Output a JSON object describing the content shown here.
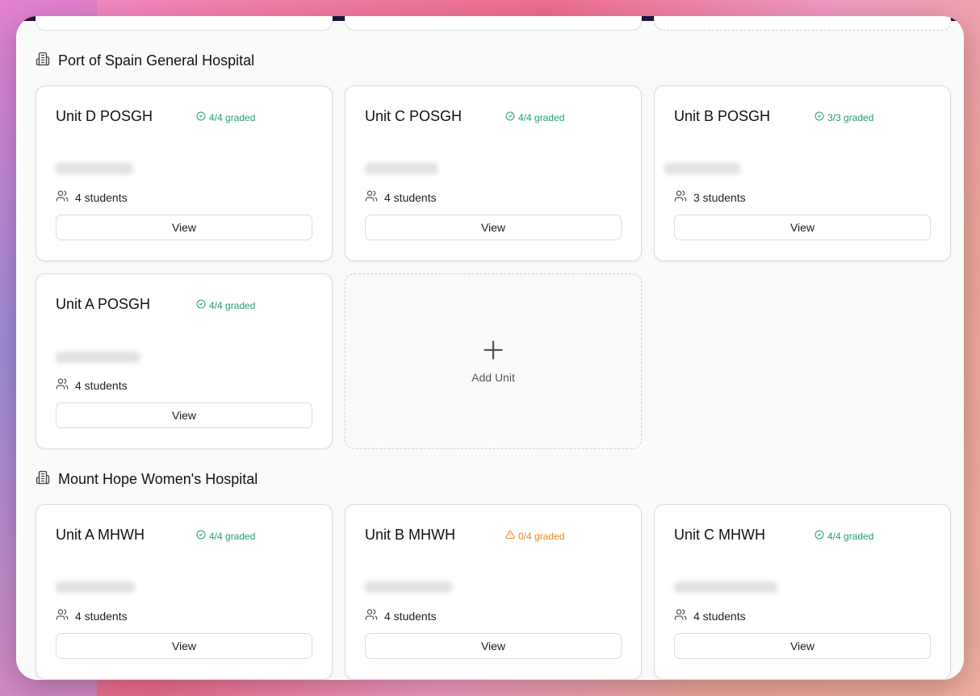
{
  "sections": [
    {
      "title": "Port of Spain General Hospital",
      "units": [
        {
          "name": "Unit D POSGH",
          "graded": "4/4 graded",
          "status": "ok",
          "students": "4 students",
          "view": "View"
        },
        {
          "name": "Unit C POSGH",
          "graded": "4/4 graded",
          "status": "ok",
          "students": "4 students",
          "view": "View"
        },
        {
          "name": "Unit B POSGH",
          "graded": "3/3 graded",
          "status": "ok",
          "students": "3 students",
          "view": "View"
        },
        {
          "name": "Unit A POSGH",
          "graded": "4/4 graded",
          "status": "ok",
          "students": "4 students",
          "view": "View"
        }
      ],
      "add_label": "Add Unit"
    },
    {
      "title": "Mount Hope Women's Hospital",
      "units": [
        {
          "name": "Unit A MHWH",
          "graded": "4/4 graded",
          "status": "ok",
          "students": "4 students",
          "view": "View"
        },
        {
          "name": "Unit B MHWH",
          "graded": "0/4 graded",
          "status": "warn",
          "students": "4 students",
          "view": "View"
        },
        {
          "name": "Unit C MHWH",
          "graded": "4/4 graded",
          "status": "ok",
          "students": "4 students",
          "view": "View"
        }
      ]
    }
  ],
  "colors": {
    "ok": "#23a06b",
    "warn": "#e08a1b",
    "topbar": "#1c1538"
  },
  "icons": {
    "section": "building-icon",
    "graded_ok": "check-circle-icon",
    "graded_warn": "warning-triangle-icon",
    "students": "users-icon",
    "add": "plus-icon"
  }
}
